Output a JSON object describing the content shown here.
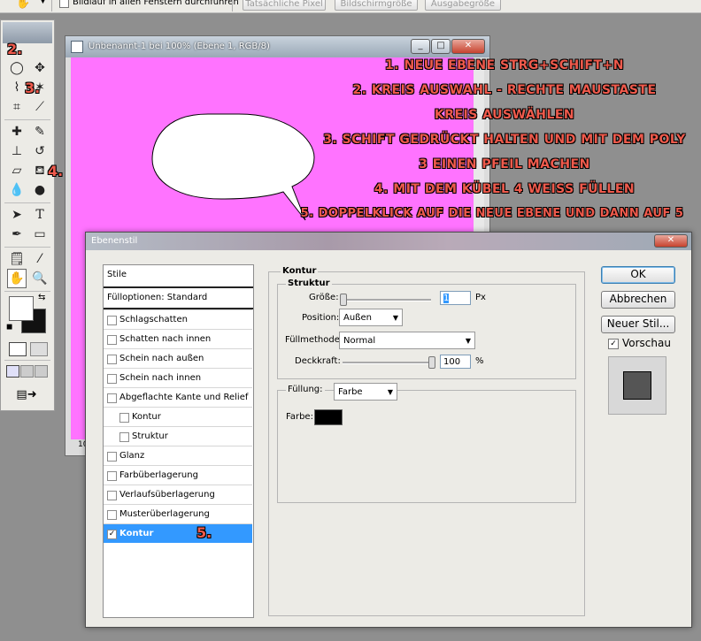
{
  "options_bar": {
    "checkbox_label": "Bildlauf in allen Fenstern durchführen",
    "buttons": [
      "Tatsächliche Pixel",
      "Bildschirmgröße",
      "Ausgabegröße"
    ]
  },
  "document": {
    "title": "Unbenannt-1 bei 100% (Ebene 1, RGB/8)",
    "zoom_fragment": "10",
    "canvas_color": "#ff73ff"
  },
  "annotations": {
    "lines": [
      "1. NEUE EBENE STRG+SCHIFT+N",
      "2. KREIS AUSWAHL - RECHTE MAUSTASTE",
      "KREIS AUSWÄHLEN",
      "3. SCHIFT GEDRÜCKT HALTEN UND MIT DEM POLY",
      "3 EINEN PFEIL MACHEN",
      "4. MIT DEM KÜBEL 4 WEISS FÜLLEN",
      "5. DOPPELKLICK AUF DIE NEUE EBENE UND DANN AUF 5"
    ],
    "markers": [
      "2.",
      "3.",
      "4.",
      "5."
    ],
    "color": "#ef5a4c"
  },
  "dialog": {
    "title": "Ebenenstil",
    "list_header": "Stile",
    "list_default": "Fülloptionen: Standard",
    "styles": [
      {
        "label": "Schlagschatten",
        "checked": false
      },
      {
        "label": "Schatten nach innen",
        "checked": false
      },
      {
        "label": "Schein nach außen",
        "checked": false
      },
      {
        "label": "Schein nach innen",
        "checked": false
      },
      {
        "label": "Abgeflachte Kante und Relief",
        "checked": false
      },
      {
        "label": "Kontur",
        "checked": false
      },
      {
        "label": "Struktur",
        "checked": false
      },
      {
        "label": "Glanz",
        "checked": false
      },
      {
        "label": "Farbüberlagerung",
        "checked": false
      },
      {
        "label": "Verlaufsüberlagerung",
        "checked": false
      },
      {
        "label": "Musterüberlagerung",
        "checked": false
      },
      {
        "label": "Kontur",
        "checked": true
      }
    ],
    "panel": {
      "section_title": "Kontur",
      "group_title": "Struktur",
      "size_label": "Größe:",
      "size_value": "1",
      "size_unit": "Px",
      "position_label": "Position:",
      "position_value": "Außen",
      "blend_label": "Füllmethode:",
      "blend_value": "Normal",
      "opacity_label": "Deckkraft:",
      "opacity_value": "100",
      "opacity_unit": "%",
      "fill_label": "Füllung:",
      "fill_value": "Farbe",
      "color_label": "Farbe:",
      "color_value": "#000000"
    },
    "buttons": {
      "ok": "OK",
      "cancel": "Abbrechen",
      "new_style": "Neuer Stil...",
      "preview": "Vorschau"
    }
  }
}
